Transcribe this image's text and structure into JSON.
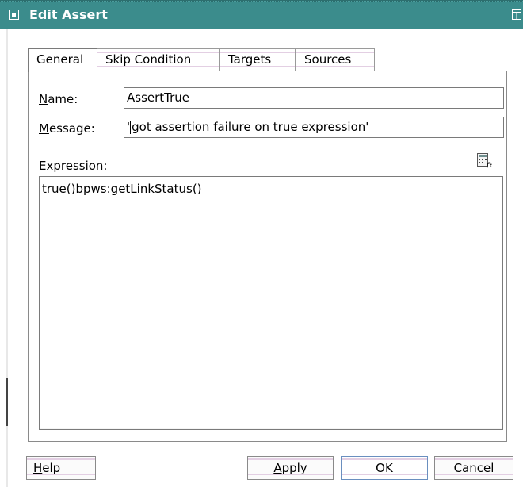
{
  "window": {
    "title": "Edit Assert",
    "window_icon": "radio-window-icon",
    "right_icon": "maximize-icon"
  },
  "tabs": [
    {
      "label": "General",
      "active": true
    },
    {
      "label": "Skip Condition",
      "active": false
    },
    {
      "label": "Targets",
      "active": false
    },
    {
      "label": "Sources",
      "active": false
    }
  ],
  "form": {
    "name_label_mn": "N",
    "name_label_rest": "ame:",
    "name_value": "AssertTrue",
    "message_label_mn": "M",
    "message_label_rest": "essage:",
    "message_value_pre": "'",
    "message_value_post": "got assertion failure on true expression'",
    "expression_label_mn": "E",
    "expression_label_rest": "xpression:",
    "expression_value": "true()bpws:getLinkStatus()",
    "expression_builder_icon": "expression-builder-icon"
  },
  "buttons": {
    "help_mn": "H",
    "help_rest": "elp",
    "apply_mn": "A",
    "apply_rest": "pply",
    "ok": "OK",
    "cancel": "Cancel"
  },
  "colors": {
    "title_bar": "#3b8c8c",
    "tab_stripe": "#e3cfe3",
    "default_button_border": "#6a8fbf"
  }
}
